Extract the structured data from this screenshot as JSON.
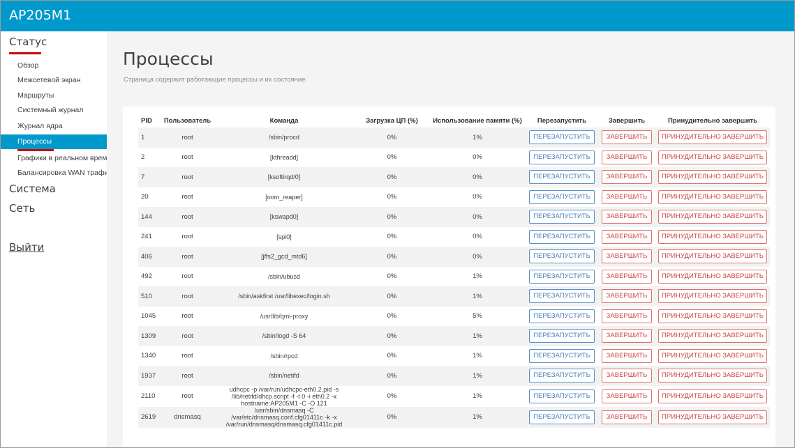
{
  "app": {
    "title": "AP205M1"
  },
  "sidebar": {
    "status_label": "Статус",
    "items": [
      {
        "label": "Обзор"
      },
      {
        "label": "Межсетевой экран"
      },
      {
        "label": "Маршруты"
      },
      {
        "label": "Системный журнал"
      },
      {
        "label": "Журнал ядра"
      },
      {
        "label": "Процессы"
      },
      {
        "label": "Графики в реальном време"
      },
      {
        "label": "Балансировка WAN трафик"
      }
    ],
    "system_label": "Система",
    "network_label": "Сеть",
    "logout_label": "Выйти"
  },
  "page": {
    "title": "Процессы",
    "subtitle": "Страница содержит работающие процессы и их состояние."
  },
  "table": {
    "headers": {
      "pid": "PID",
      "user": "Пользователь",
      "command": "Команда",
      "cpu": "Загрузка ЦП (%)",
      "mem": "Использование памяти (%)",
      "restart": "Перезапустить",
      "kill": "Завершить",
      "force": "Принудительно завершить"
    },
    "buttons": {
      "restart": "ПЕРЕЗАПУСТИТЬ",
      "kill": "ЗАВЕРШИТЬ",
      "force": "ПРИНУДИТЕЛЬНО ЗАВЕРШИТЬ"
    },
    "rows": [
      {
        "pid": "1",
        "user": "root",
        "command": "/sbin/procd",
        "cpu": "0%",
        "mem": "1%"
      },
      {
        "pid": "2",
        "user": "root",
        "command": "[kthreadd]",
        "cpu": "0%",
        "mem": "0%"
      },
      {
        "pid": "7",
        "user": "root",
        "command": "[ksoftirqd/0]",
        "cpu": "0%",
        "mem": "0%"
      },
      {
        "pid": "20",
        "user": "root",
        "command": "[oom_reaper]",
        "cpu": "0%",
        "mem": "0%"
      },
      {
        "pid": "144",
        "user": "root",
        "command": "[kswapd0]",
        "cpu": "0%",
        "mem": "0%"
      },
      {
        "pid": "241",
        "user": "root",
        "command": "[spi0]",
        "cpu": "0%",
        "mem": "0%"
      },
      {
        "pid": "406",
        "user": "root",
        "command": "[jffs2_gcd_mtd6]",
        "cpu": "0%",
        "mem": "0%"
      },
      {
        "pid": "492",
        "user": "root",
        "command": "/sbin/ubusd",
        "cpu": "0%",
        "mem": "1%"
      },
      {
        "pid": "510",
        "user": "root",
        "command": "/sbin/askfirst /usr/libexec/login.sh",
        "cpu": "0%",
        "mem": "1%"
      },
      {
        "pid": "1045",
        "user": "root",
        "command": "/usr/lib/qmi-proxy",
        "cpu": "0%",
        "mem": "5%"
      },
      {
        "pid": "1309",
        "user": "root",
        "command": "/sbin/logd -S 64",
        "cpu": "0%",
        "mem": "1%"
      },
      {
        "pid": "1340",
        "user": "root",
        "command": "/sbin/rpcd",
        "cpu": "0%",
        "mem": "1%"
      },
      {
        "pid": "1937",
        "user": "root",
        "command": "/sbin/netifd",
        "cpu": "0%",
        "mem": "1%"
      },
      {
        "pid": "2110",
        "user": "root",
        "command": "udhcpc -p /var/run/udhcpc-eth0.2.pid -s /lib/netifd/dhcp.script -f -t 0 -i eth0.2 -x hostname:AP205M1 -C -O 121",
        "cpu": "0%",
        "mem": "1%"
      },
      {
        "pid": "2619",
        "user": "dnsmasq",
        "command": "/usr/sbin/dnsmasq -C /var/etc/dnsmasq.conf.cfg01411c -k -x /var/run/dnsmasq/dnsmasq.cfg01411c.pid",
        "cpu": "0%",
        "mem": "1%"
      }
    ]
  },
  "colors": {
    "brand": "#0099cc",
    "active_menu": "#0099cc",
    "section_underline": "#cc0000",
    "restart_button": "#4a7fb8",
    "kill_button": "#cc4444"
  }
}
